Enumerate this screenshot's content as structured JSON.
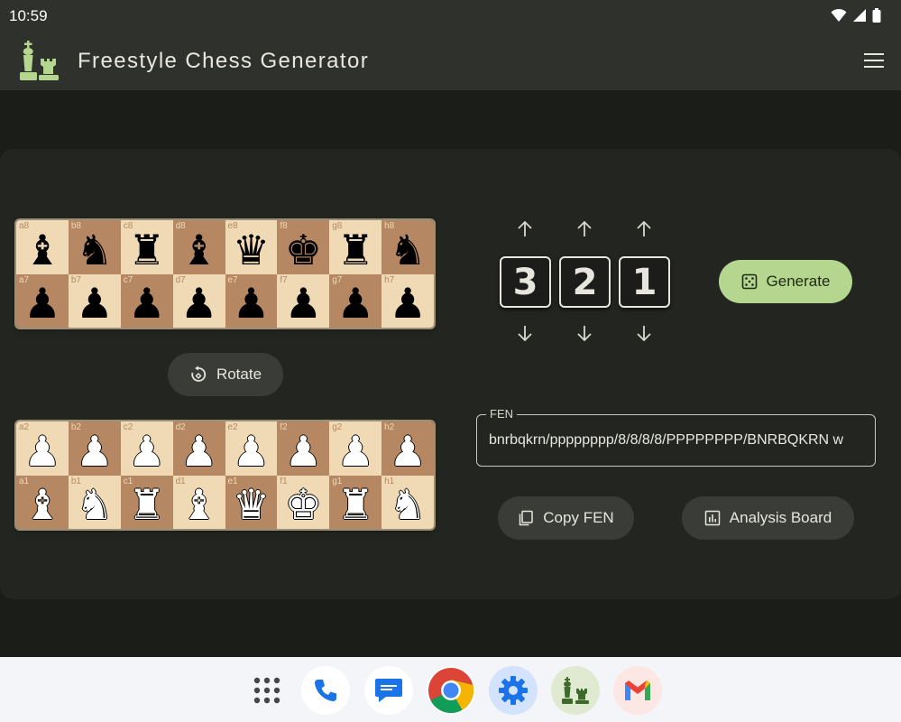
{
  "status": {
    "time": "10:59"
  },
  "app": {
    "title": "Freestyle Chess Generator"
  },
  "top_board": [
    {
      "coord": "a8",
      "piece": "♝",
      "color": "black",
      "shade": "light"
    },
    {
      "coord": "b8",
      "piece": "♞",
      "color": "black",
      "shade": "dark"
    },
    {
      "coord": "c8",
      "piece": "♜",
      "color": "black",
      "shade": "light"
    },
    {
      "coord": "d8",
      "piece": "♝",
      "color": "black",
      "shade": "dark"
    },
    {
      "coord": "e8",
      "piece": "♛",
      "color": "black",
      "shade": "light"
    },
    {
      "coord": "f8",
      "piece": "♚",
      "color": "black",
      "shade": "dark"
    },
    {
      "coord": "g8",
      "piece": "♜",
      "color": "black",
      "shade": "light"
    },
    {
      "coord": "h8",
      "piece": "♞",
      "color": "black",
      "shade": "dark"
    },
    {
      "coord": "a7",
      "piece": "♟",
      "color": "black",
      "shade": "dark"
    },
    {
      "coord": "b7",
      "piece": "♟",
      "color": "black",
      "shade": "light"
    },
    {
      "coord": "c7",
      "piece": "♟",
      "color": "black",
      "shade": "dark"
    },
    {
      "coord": "d7",
      "piece": "♟",
      "color": "black",
      "shade": "light"
    },
    {
      "coord": "e7",
      "piece": "♟",
      "color": "black",
      "shade": "dark"
    },
    {
      "coord": "f7",
      "piece": "♟",
      "color": "black",
      "shade": "light"
    },
    {
      "coord": "g7",
      "piece": "♟",
      "color": "black",
      "shade": "dark"
    },
    {
      "coord": "h7",
      "piece": "♟",
      "color": "black",
      "shade": "light"
    }
  ],
  "bottom_board": [
    {
      "coord": "a2",
      "piece": "♟",
      "color": "white",
      "shade": "light"
    },
    {
      "coord": "b2",
      "piece": "♟",
      "color": "white",
      "shade": "dark"
    },
    {
      "coord": "c2",
      "piece": "♟",
      "color": "white",
      "shade": "light"
    },
    {
      "coord": "d2",
      "piece": "♟",
      "color": "white",
      "shade": "dark"
    },
    {
      "coord": "e2",
      "piece": "♟",
      "color": "white",
      "shade": "light"
    },
    {
      "coord": "f2",
      "piece": "♟",
      "color": "white",
      "shade": "dark"
    },
    {
      "coord": "g2",
      "piece": "♟",
      "color": "white",
      "shade": "light"
    },
    {
      "coord": "h2",
      "piece": "♟",
      "color": "white",
      "shade": "dark"
    },
    {
      "coord": "a1",
      "piece": "♝",
      "color": "white",
      "shade": "dark"
    },
    {
      "coord": "b1",
      "piece": "♞",
      "color": "white",
      "shade": "light"
    },
    {
      "coord": "c1",
      "piece": "♜",
      "color": "white",
      "shade": "dark"
    },
    {
      "coord": "d1",
      "piece": "♝",
      "color": "white",
      "shade": "light"
    },
    {
      "coord": "e1",
      "piece": "♛",
      "color": "white",
      "shade": "dark"
    },
    {
      "coord": "f1",
      "piece": "♚",
      "color": "white",
      "shade": "light"
    },
    {
      "coord": "g1",
      "piece": "♜",
      "color": "white",
      "shade": "dark"
    },
    {
      "coord": "h1",
      "piece": "♞",
      "color": "white",
      "shade": "light"
    }
  ],
  "controls": {
    "rotate_label": "Rotate",
    "generate_label": "Generate",
    "copy_fen_label": "Copy FEN",
    "analysis_label": "Analysis Board",
    "digits": [
      "3",
      "2",
      "1"
    ]
  },
  "fen": {
    "label": "FEN",
    "value": "bnrbqkrn/pppppppp/8/8/8/8/PPPPPPPP/BNRBQKRN w"
  },
  "colors": {
    "accent": "#b5d68f",
    "light_square": "#f0dab5",
    "dark_square": "#b58863"
  },
  "dock": [
    "apps-grid-icon",
    "phone-icon",
    "messages-icon",
    "chrome-icon",
    "settings-icon",
    "freestyle-chess-icon",
    "gmail-icon"
  ]
}
